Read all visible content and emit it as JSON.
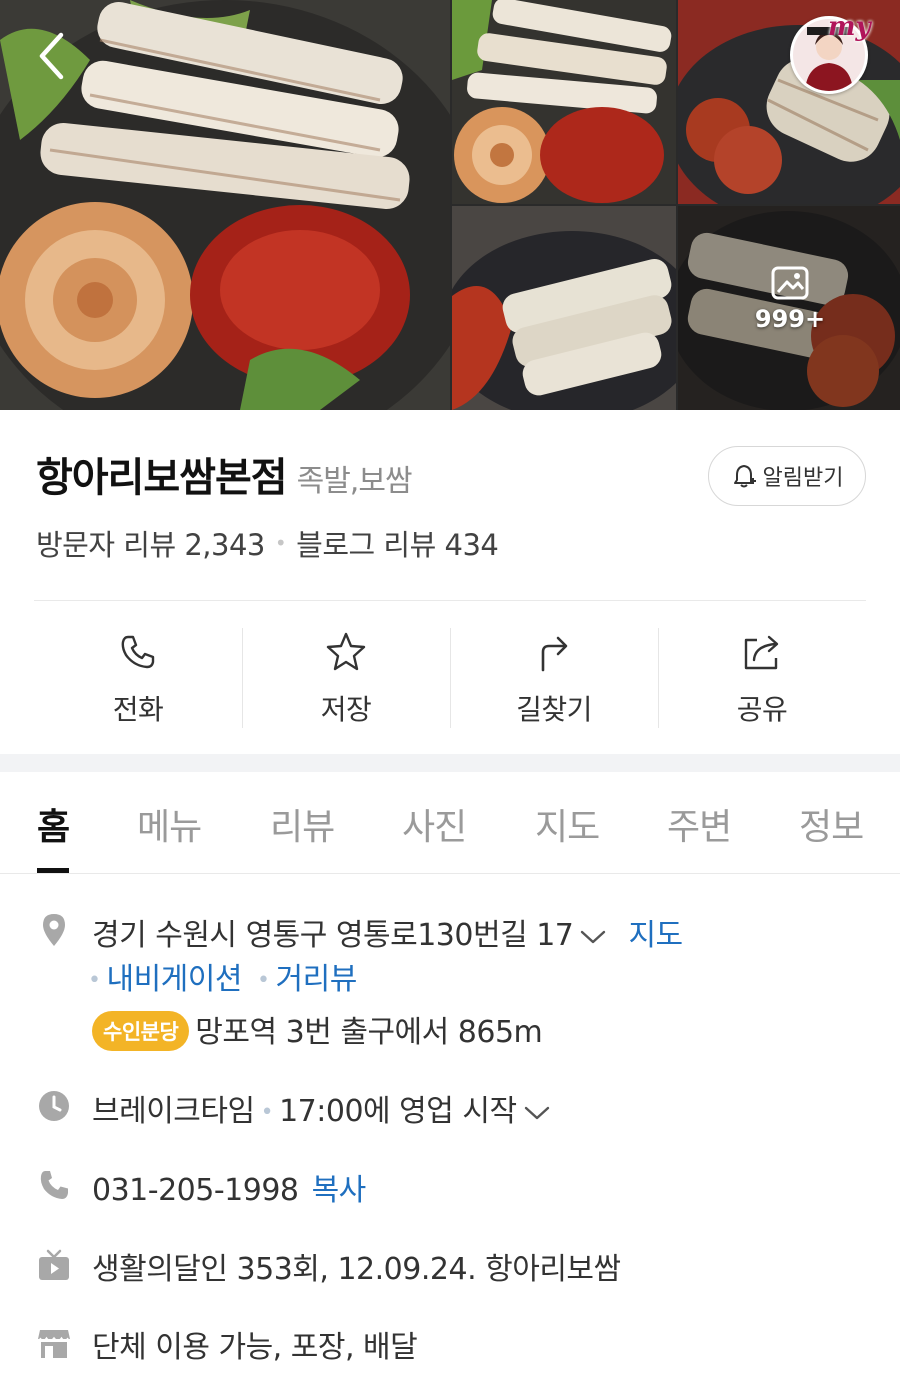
{
  "gallery": {
    "more_count": "999+",
    "avatar_badge": "my"
  },
  "place": {
    "name": "항아리보쌈본점",
    "category": "족발,보쌈",
    "alarm_label": "알림받기",
    "visitor_review_label": "방문자 리뷰 2,343",
    "blog_review_label": "블로그 리뷰 434"
  },
  "actions": [
    {
      "label": "전화",
      "icon": "phone-icon"
    },
    {
      "label": "저장",
      "icon": "star-icon"
    },
    {
      "label": "길찾기",
      "icon": "directions-icon"
    },
    {
      "label": "공유",
      "icon": "share-icon"
    }
  ],
  "tabs": [
    "홈",
    "메뉴",
    "리뷰",
    "사진",
    "지도",
    "주변",
    "정보"
  ],
  "active_tab": "홈",
  "info": {
    "address": "경기 수원시 영통구 영통로130번길 17",
    "map_link": "지도",
    "navigation_link": "내비게이션",
    "streetview_link": "거리뷰",
    "subway_line": "수인분당",
    "subway_directions": "망포역 3번 출구에서 865m",
    "hours_status": "브레이크타임",
    "hours_detail": "17:00에 영업 시작",
    "phone": "031-205-1998",
    "copy_label": "복사",
    "tv": "생활의달인 353회, 12.09.24. 항아리보쌈",
    "facilities": "단체 이용 가능, 포장, 배달"
  },
  "colors": {
    "link": "#1f6fbf",
    "subway_badge": "#f3b426"
  }
}
